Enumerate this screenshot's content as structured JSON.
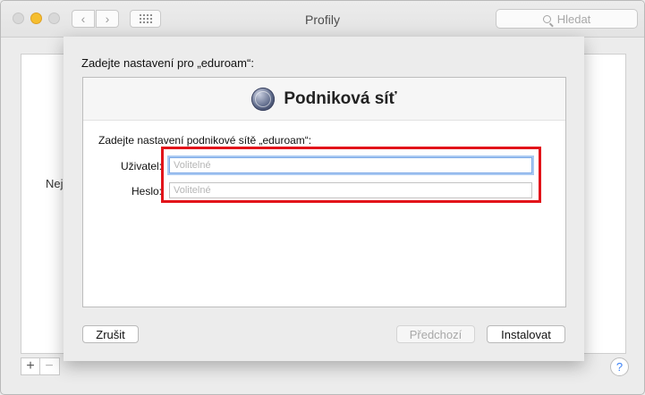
{
  "window": {
    "title": "Profily"
  },
  "toolbar": {
    "back_icon": "chevron-left-icon",
    "forward_icon": "chevron-right-icon",
    "grid_icon": "grid-icon",
    "search_placeholder": "Hledat"
  },
  "background": {
    "partial_text": "Nej",
    "add_label": "+",
    "remove_label": "−",
    "help_label": "?"
  },
  "sheet": {
    "title": "Zadejte nastavení pro „eduroam“:",
    "header_title": "Podniková síť",
    "subtitle": "Zadejte nastavení podnikové sítě „eduroam“:",
    "user_label": "Uživatel:",
    "user_placeholder": "Volitelné",
    "password_label": "Heslo:",
    "password_placeholder": "Volitelné",
    "cancel_label": "Zrušit",
    "previous_label": "Předchozí",
    "install_label": "Instalovat"
  },
  "colors": {
    "highlight": "#e2141a",
    "focus_ring": "#a9c9f2",
    "minimize_button": "#f5be2f"
  }
}
